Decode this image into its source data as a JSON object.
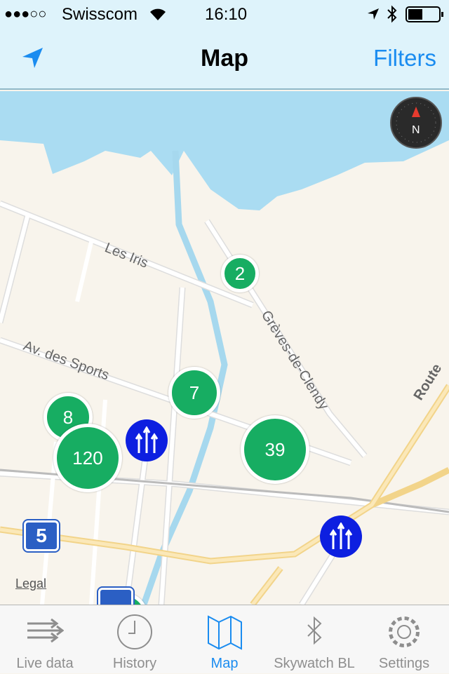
{
  "status_bar": {
    "signal": "●●●○○",
    "carrier": "Swisscom",
    "time": "16:10"
  },
  "nav": {
    "title": "Map",
    "filters_label": "Filters",
    "location_icon": "location-arrow-icon"
  },
  "map": {
    "street_labels": [
      "Les Iris",
      "Av. des Sports",
      "Grèves-de-Clendy",
      "Route"
    ],
    "clusters": [
      {
        "count": "2"
      },
      {
        "count": "7"
      },
      {
        "count": "8"
      },
      {
        "count": "120"
      },
      {
        "count": "39"
      }
    ],
    "route_sign": "5",
    "legal": "Legal",
    "colors": {
      "cluster": "#17ad62",
      "bluetooth_marker": "#0d1fe0",
      "water": "#aadcf2",
      "land": "#f8f4ec"
    }
  },
  "tabs": [
    {
      "label": "Live data",
      "icon": "live-data-icon"
    },
    {
      "label": "History",
      "icon": "clock-icon"
    },
    {
      "label": "Map",
      "icon": "map-icon",
      "active": true
    },
    {
      "label": "Skywatch BL",
      "icon": "bluetooth-icon"
    },
    {
      "label": "Settings",
      "icon": "gear-icon"
    }
  ]
}
